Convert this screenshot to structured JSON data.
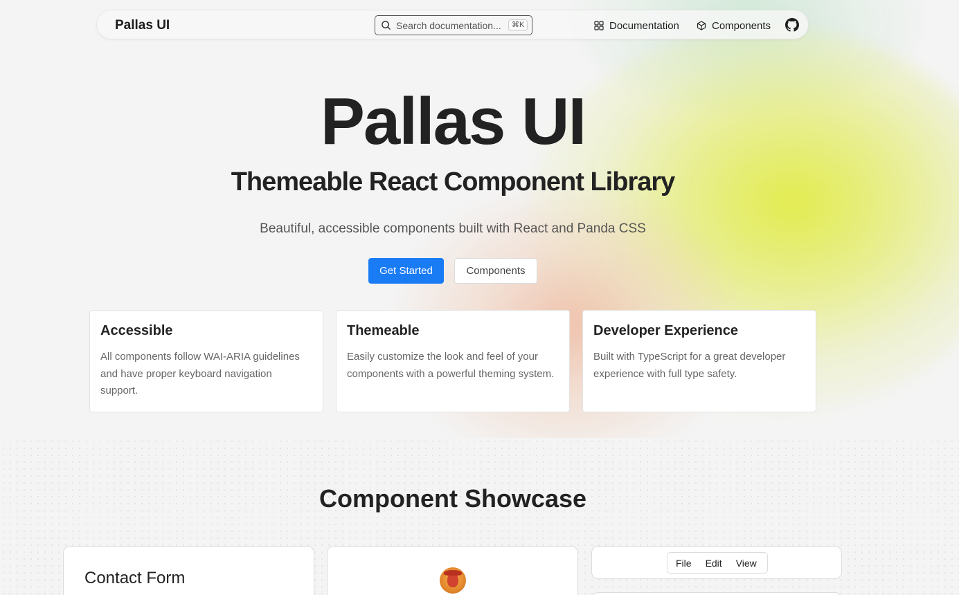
{
  "nav": {
    "brand": "Pallas UI",
    "search_placeholder": "Search documentation...",
    "search_shortcut": "⌘K",
    "links": [
      {
        "label": "Documentation",
        "icon": "grid-icon"
      },
      {
        "label": "Components",
        "icon": "box-icon"
      }
    ],
    "github_icon": "github-icon"
  },
  "hero": {
    "title": "Pallas UI",
    "subtitle": "Themeable React Component Library",
    "description": "Beautiful, accessible components built with React and Panda CSS",
    "primary_button": "Get Started",
    "secondary_button": "Components",
    "accent_color": "#1a7cf5"
  },
  "features": [
    {
      "title": "Accessible",
      "body": "All components follow WAI-ARIA guidelines and have proper keyboard navigation support."
    },
    {
      "title": "Themeable",
      "body": "Easily customize the look and feel of your components with a powerful theming system."
    },
    {
      "title": "Developer Experience",
      "body": "Built with TypeScript for a great developer experience with full type safety."
    }
  ],
  "showcase": {
    "title": "Component Showcase",
    "contact_form_title": "Contact Form",
    "menubar": [
      "File",
      "Edit",
      "View"
    ]
  }
}
